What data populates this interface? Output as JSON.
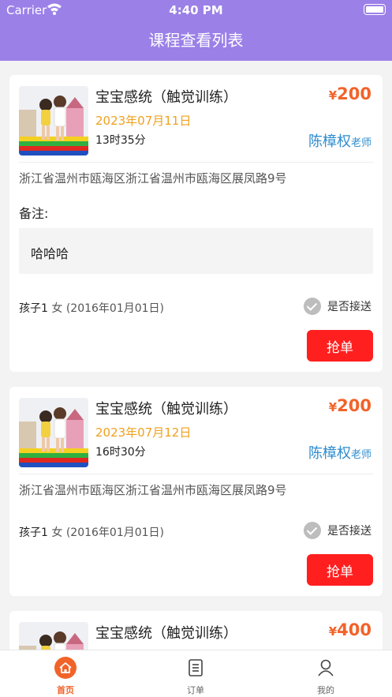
{
  "status_bar": {
    "carrier": "Carrier",
    "time": "4:40 PM"
  },
  "nav": {
    "title": "课程查看列表"
  },
  "orders": [
    {
      "title": "宝宝感统（触觉训练）",
      "currency": "¥",
      "price": "200",
      "date": "2023年07月11日",
      "duration": "13时35分",
      "teacher_name": "陈樟权",
      "teacher_role": "老师",
      "address": "浙江省温州市瓯海区浙江省温州市瓯海区展凤路9号",
      "remark_label": "备注:",
      "remark": "哈哈哈",
      "child_name": "孩子1",
      "child_info": " 女 (2016年01月01日)",
      "pickup_label": "是否接送",
      "grab_label": "抢单"
    },
    {
      "title": "宝宝感统（触觉训练）",
      "currency": "¥",
      "price": "200",
      "date": "2023年07月12日",
      "duration": "16时30分",
      "teacher_name": "陈樟权",
      "teacher_role": "老师",
      "address": "浙江省温州市瓯海区浙江省温州市瓯海区展凤路9号",
      "child_name": "孩子1",
      "child_info": " 女 (2016年01月01日)",
      "pickup_label": "是否接送",
      "grab_label": "抢单"
    },
    {
      "title": "宝宝感统（触觉训练）",
      "currency": "¥",
      "price": "400"
    }
  ],
  "tabs": [
    {
      "label": "首页",
      "icon": "home-icon",
      "active": true
    },
    {
      "label": "订单",
      "icon": "orders-icon",
      "active": false
    },
    {
      "label": "我的",
      "icon": "profile-icon",
      "active": false
    }
  ],
  "colors": {
    "header": "#9b80e8",
    "price": "#f2632a",
    "date": "#f0a020",
    "teacher": "#2d8ccf",
    "grab_button": "#ff1f1f"
  }
}
